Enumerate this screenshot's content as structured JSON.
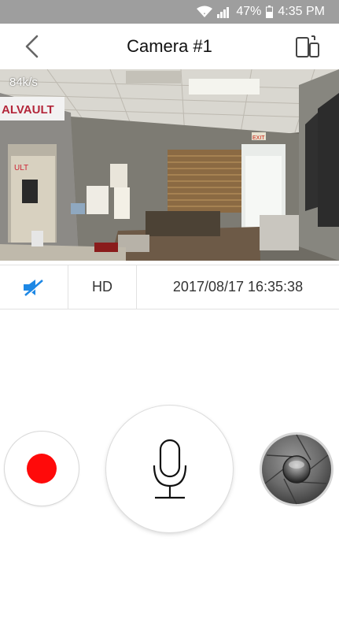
{
  "status_bar": {
    "battery": "47%",
    "time": "4:35 PM"
  },
  "header": {
    "title": "Camera #1"
  },
  "video": {
    "bitrate": "84k/s",
    "sign_text": "ALVAULT",
    "exit_sign": "EXIT"
  },
  "controls": {
    "quality": "HD",
    "timestamp": "2017/08/17 16:35:38"
  },
  "colors": {
    "record": "#ff0a0a",
    "mute_icon": "#1e88e5",
    "status_bar": "#9e9e9e"
  },
  "icons": [
    "chevron-left-icon",
    "device-switch-icon",
    "mute-speaker-icon",
    "record-icon",
    "microphone-icon",
    "camera-shutter-icon",
    "wifi-icon",
    "signal-icon",
    "battery-icon"
  ]
}
